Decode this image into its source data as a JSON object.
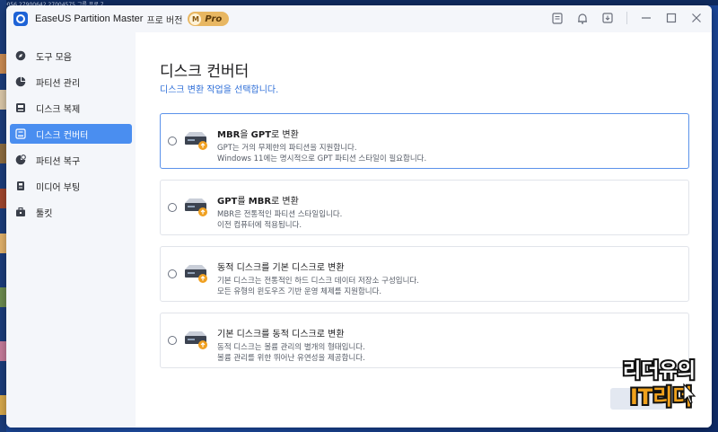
{
  "window": {
    "app_title": "EaseUS Partition Master",
    "edition": "프로 버전",
    "badge_letter": "M",
    "badge_text": "Pro"
  },
  "titlebar_icons": [
    "feedback-icon",
    "bell-icon",
    "download-icon",
    "minimize-icon",
    "maximize-icon",
    "close-icon"
  ],
  "sidebar": {
    "items": [
      {
        "label": "도구 모음",
        "icon": "compass-icon",
        "active": false
      },
      {
        "label": "파티션 관리",
        "icon": "pie-chart-icon",
        "active": false
      },
      {
        "label": "디스크 복제",
        "icon": "disk-clone-icon",
        "active": false
      },
      {
        "label": "디스크 컨버터",
        "icon": "disk-convert-icon",
        "active": true
      },
      {
        "label": "파티션 복구",
        "icon": "partition-recovery-icon",
        "active": false
      },
      {
        "label": "미디어 부팅",
        "icon": "media-boot-icon",
        "active": false
      },
      {
        "label": "툴킷",
        "icon": "toolbox-icon",
        "active": false
      }
    ]
  },
  "main": {
    "title": "디스크 컨버터",
    "subtitle": "디스크 변환 작업을 선택합니다.",
    "options": [
      {
        "title_a": "MBR",
        "title_b": "을 ",
        "title_c": "GPT",
        "title_d": "로 변환",
        "desc1": "GPT는 거의 무제한의 파티션을 지원합니다.",
        "desc2": "Windows 11에는 명시적으로 GPT 파티션 스타일이 필요합니다.",
        "selected": true
      },
      {
        "title_a": "GPT",
        "title_b": "를 ",
        "title_c": "MBR",
        "title_d": "로 변환",
        "desc1": "MBR은 전통적인 파티션 스타일입니다.",
        "desc2": "이전 컴퓨터에 적용됩니다.",
        "selected": false
      },
      {
        "title_a": "동적 디스크를 기본 디스크로 변환",
        "title_b": "",
        "title_c": "",
        "title_d": "",
        "desc1": "기본 디스크는 전통적인 하드 디스크 데이터 저장소 구성입니다.",
        "desc2": "모든 유형의 윈도우즈 기반 운영 체제를 지원합니다.",
        "selected": false
      },
      {
        "title_a": "기본 디스크를 동적 디스크로 변환",
        "title_b": "",
        "title_c": "",
        "title_d": "",
        "desc1": "동적 디스크는 볼륨 관리의 별개의 형태입니다.",
        "desc2": "볼륨 관리를 위한 뛰어난 유연성을 제공합니다.",
        "selected": false
      }
    ]
  },
  "desktop_strip_text": "39056   27900642   27004575   그룹 프로 7",
  "watermark": {
    "line1": "리더유의",
    "line2": "IT리더"
  },
  "colors": {
    "accent": "#4a8ef0",
    "subtitle_blue": "#2f6fd8",
    "badge_gold": "#e8b762",
    "sidebar_bg": "#f4f6fa"
  }
}
